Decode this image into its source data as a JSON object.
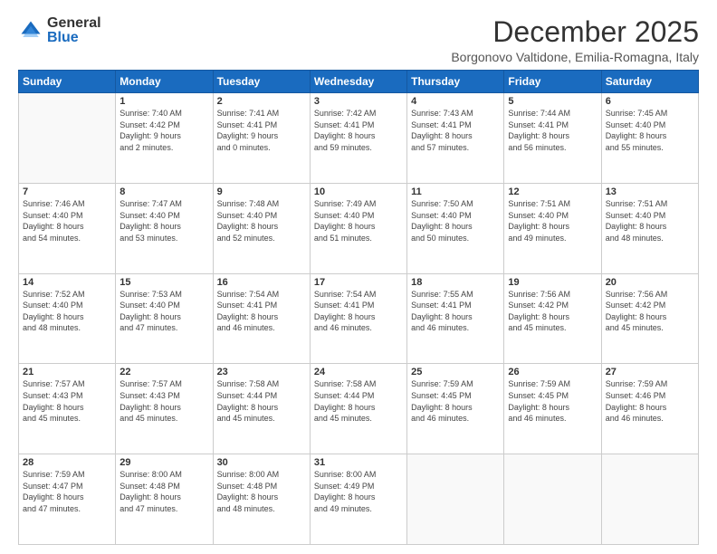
{
  "logo": {
    "general": "General",
    "blue": "Blue"
  },
  "header": {
    "month": "December 2025",
    "location": "Borgonovo Valtidone, Emilia-Romagna, Italy"
  },
  "days_of_week": [
    "Sunday",
    "Monday",
    "Tuesday",
    "Wednesday",
    "Thursday",
    "Friday",
    "Saturday"
  ],
  "weeks": [
    [
      {
        "day": "",
        "info": ""
      },
      {
        "day": "1",
        "info": "Sunrise: 7:40 AM\nSunset: 4:42 PM\nDaylight: 9 hours\nand 2 minutes."
      },
      {
        "day": "2",
        "info": "Sunrise: 7:41 AM\nSunset: 4:41 PM\nDaylight: 9 hours\nand 0 minutes."
      },
      {
        "day": "3",
        "info": "Sunrise: 7:42 AM\nSunset: 4:41 PM\nDaylight: 8 hours\nand 59 minutes."
      },
      {
        "day": "4",
        "info": "Sunrise: 7:43 AM\nSunset: 4:41 PM\nDaylight: 8 hours\nand 57 minutes."
      },
      {
        "day": "5",
        "info": "Sunrise: 7:44 AM\nSunset: 4:41 PM\nDaylight: 8 hours\nand 56 minutes."
      },
      {
        "day": "6",
        "info": "Sunrise: 7:45 AM\nSunset: 4:40 PM\nDaylight: 8 hours\nand 55 minutes."
      }
    ],
    [
      {
        "day": "7",
        "info": "Sunrise: 7:46 AM\nSunset: 4:40 PM\nDaylight: 8 hours\nand 54 minutes."
      },
      {
        "day": "8",
        "info": "Sunrise: 7:47 AM\nSunset: 4:40 PM\nDaylight: 8 hours\nand 53 minutes."
      },
      {
        "day": "9",
        "info": "Sunrise: 7:48 AM\nSunset: 4:40 PM\nDaylight: 8 hours\nand 52 minutes."
      },
      {
        "day": "10",
        "info": "Sunrise: 7:49 AM\nSunset: 4:40 PM\nDaylight: 8 hours\nand 51 minutes."
      },
      {
        "day": "11",
        "info": "Sunrise: 7:50 AM\nSunset: 4:40 PM\nDaylight: 8 hours\nand 50 minutes."
      },
      {
        "day": "12",
        "info": "Sunrise: 7:51 AM\nSunset: 4:40 PM\nDaylight: 8 hours\nand 49 minutes."
      },
      {
        "day": "13",
        "info": "Sunrise: 7:51 AM\nSunset: 4:40 PM\nDaylight: 8 hours\nand 48 minutes."
      }
    ],
    [
      {
        "day": "14",
        "info": "Sunrise: 7:52 AM\nSunset: 4:40 PM\nDaylight: 8 hours\nand 48 minutes."
      },
      {
        "day": "15",
        "info": "Sunrise: 7:53 AM\nSunset: 4:40 PM\nDaylight: 8 hours\nand 47 minutes."
      },
      {
        "day": "16",
        "info": "Sunrise: 7:54 AM\nSunset: 4:41 PM\nDaylight: 8 hours\nand 46 minutes."
      },
      {
        "day": "17",
        "info": "Sunrise: 7:54 AM\nSunset: 4:41 PM\nDaylight: 8 hours\nand 46 minutes."
      },
      {
        "day": "18",
        "info": "Sunrise: 7:55 AM\nSunset: 4:41 PM\nDaylight: 8 hours\nand 46 minutes."
      },
      {
        "day": "19",
        "info": "Sunrise: 7:56 AM\nSunset: 4:42 PM\nDaylight: 8 hours\nand 45 minutes."
      },
      {
        "day": "20",
        "info": "Sunrise: 7:56 AM\nSunset: 4:42 PM\nDaylight: 8 hours\nand 45 minutes."
      }
    ],
    [
      {
        "day": "21",
        "info": "Sunrise: 7:57 AM\nSunset: 4:43 PM\nDaylight: 8 hours\nand 45 minutes."
      },
      {
        "day": "22",
        "info": "Sunrise: 7:57 AM\nSunset: 4:43 PM\nDaylight: 8 hours\nand 45 minutes."
      },
      {
        "day": "23",
        "info": "Sunrise: 7:58 AM\nSunset: 4:44 PM\nDaylight: 8 hours\nand 45 minutes."
      },
      {
        "day": "24",
        "info": "Sunrise: 7:58 AM\nSunset: 4:44 PM\nDaylight: 8 hours\nand 45 minutes."
      },
      {
        "day": "25",
        "info": "Sunrise: 7:59 AM\nSunset: 4:45 PM\nDaylight: 8 hours\nand 46 minutes."
      },
      {
        "day": "26",
        "info": "Sunrise: 7:59 AM\nSunset: 4:45 PM\nDaylight: 8 hours\nand 46 minutes."
      },
      {
        "day": "27",
        "info": "Sunrise: 7:59 AM\nSunset: 4:46 PM\nDaylight: 8 hours\nand 46 minutes."
      }
    ],
    [
      {
        "day": "28",
        "info": "Sunrise: 7:59 AM\nSunset: 4:47 PM\nDaylight: 8 hours\nand 47 minutes."
      },
      {
        "day": "29",
        "info": "Sunrise: 8:00 AM\nSunset: 4:48 PM\nDaylight: 8 hours\nand 47 minutes."
      },
      {
        "day": "30",
        "info": "Sunrise: 8:00 AM\nSunset: 4:48 PM\nDaylight: 8 hours\nand 48 minutes."
      },
      {
        "day": "31",
        "info": "Sunrise: 8:00 AM\nSunset: 4:49 PM\nDaylight: 8 hours\nand 49 minutes."
      },
      {
        "day": "",
        "info": ""
      },
      {
        "day": "",
        "info": ""
      },
      {
        "day": "",
        "info": ""
      }
    ]
  ]
}
